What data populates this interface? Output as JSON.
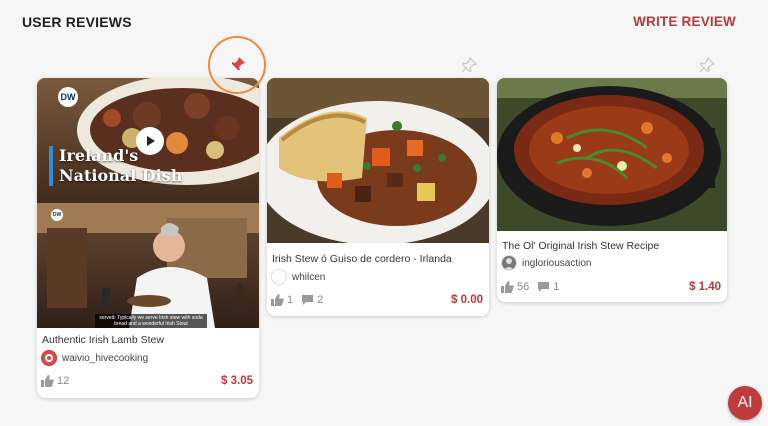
{
  "header": {
    "title": "USER REVIEWS",
    "write_label": "WRITE REVIEW"
  },
  "colors": {
    "accent": "#b73a3a",
    "highlight_ring": "#ef8a3a",
    "pin_active": "#d64545",
    "pin_inactive": "#cfcfcf"
  },
  "cards": [
    {
      "title": "Authentic Irish Lamb Stew",
      "author": "waivio_hivecooking",
      "likes": "12",
      "comments": "",
      "price": "$ 3.05",
      "pinned": true,
      "video": {
        "logo": "DW",
        "title_line1": "Ireland's",
        "title_line2": "National Dish",
        "subtitle": "served: Typically we serve Irish stew with soda bread and a wonderful Irish Stout"
      }
    },
    {
      "title": "Irish Stew ó Guiso de cordero - Irlanda",
      "author": "whilcen",
      "likes": "1",
      "comments": "2",
      "price": "$ 0.00",
      "pinned": false
    },
    {
      "title": "The Ol' Original Irish Stew Recipe",
      "author": "ingloriousaction",
      "likes": "56",
      "comments": "1",
      "price": "$ 1.40",
      "pinned": false
    }
  ],
  "ai_button": {
    "label": "AI"
  }
}
